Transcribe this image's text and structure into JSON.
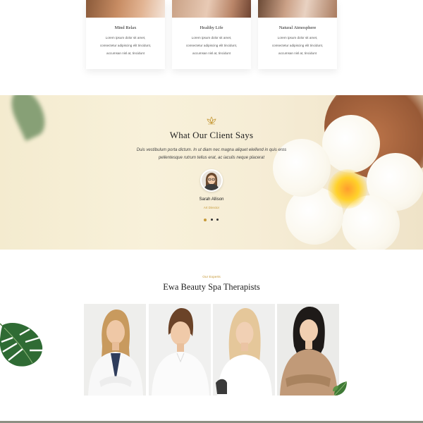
{
  "services": {
    "cards": [
      {
        "title": "Mind Relax",
        "lines": [
          "Lorem ipsum dolor sit amet,",
          "consectetur adipiscing elit tincidunt,",
          "accumsan nisl at, tincidunt"
        ]
      },
      {
        "title": "Healthy Life",
        "lines": [
          "Lorem ipsum dolor sit amet,",
          "consectetur adipiscing elit tincidunt,",
          "accumsan nisl at, tincidunt"
        ]
      },
      {
        "title": "Natural Atmosphere",
        "lines": [
          "Lorem ipsum dolor sit amet,",
          "consectetur adipiscing elit tincidunt,",
          "accumsan nisl at, tincidunt"
        ]
      }
    ]
  },
  "testimonial": {
    "icon": "lotus-icon",
    "title": "What Our Client Says",
    "quote_lines": [
      "Duis vestibulum porta dictum. In ut diam nec magna aliquet eleifend in quis eros",
      "pellentesque rutrum tellus erat, ac iaculis neque placerat"
    ],
    "name": "Sarah Allison",
    "role": "Art Director",
    "dots_count": 3,
    "active_dot": 0
  },
  "experts": {
    "eyebrow": "Our Experts",
    "title": "Ewa Beauty Spa Therapists"
  },
  "colors": {
    "accent": "#c79a3a",
    "heading": "#1f1f1f",
    "testimonial_bg": "#f6edd6"
  }
}
